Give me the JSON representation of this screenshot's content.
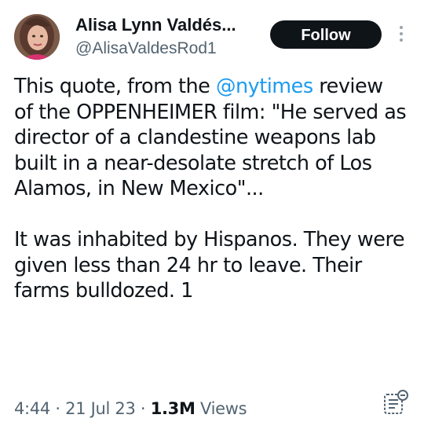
{
  "author": {
    "display_name": "Alisa Lynn Valdés...",
    "handle": "@AlisaValdesRod1"
  },
  "follow_button": {
    "label": "Follow"
  },
  "more_menu": {
    "icon": "more-vertical-icon"
  },
  "tweet": {
    "line1_prefix": "This quote, from the ",
    "mention": "@nytimes",
    "line1_rest": "review of the OPPENHEIMER film: \"He served as director of a clandestine weapons lab built in a near-desolate stretch of Los Alamos, in New Mexico\"...",
    "paragraph2": "It was inhabited by Hispanos. They were given less than 24 hr to leave. Their farms bulldozed. 1"
  },
  "meta": {
    "time": "4:44",
    "separator1": " · ",
    "date": "21 Jul 23",
    "separator2": " · ",
    "view_count": "1.3M",
    "views_label": " Views"
  },
  "note_icon": {
    "icon": "note-settings-icon"
  }
}
